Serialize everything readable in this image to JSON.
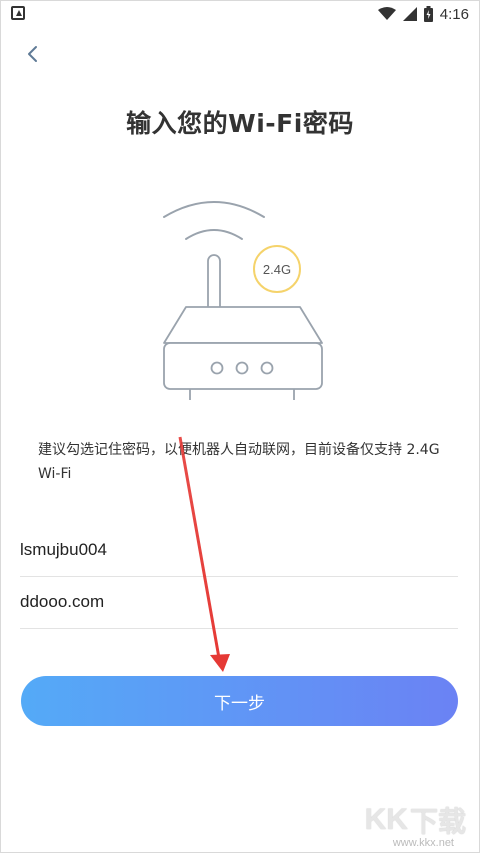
{
  "status_bar": {
    "time": "4:16",
    "icons": [
      "notification-a-icon",
      "wifi-icon",
      "signal-icon",
      "battery-icon"
    ]
  },
  "header": {
    "back_icon": "chevron-left-icon",
    "title": "输入您的Wi-Fi密码"
  },
  "illustration": {
    "band_badge": "2.4G",
    "badge_color": "#f5d36b"
  },
  "hint": {
    "text": "建议勾选记住密码，以便机器人自动联网，目前设备仅支持 2.4G Wi-Fi"
  },
  "form": {
    "ssid_value": "lsmujbu004",
    "password_value": "ddooo.com"
  },
  "actions": {
    "next_label": "下一步",
    "gradient_start": "#54aaf7",
    "gradient_end": "#6b82f4"
  },
  "watermark": {
    "brand_latin": "KK",
    "brand_cn": "下载",
    "url": "www.kkx.net"
  },
  "annotation": {
    "arrow_color": "#e53935"
  }
}
